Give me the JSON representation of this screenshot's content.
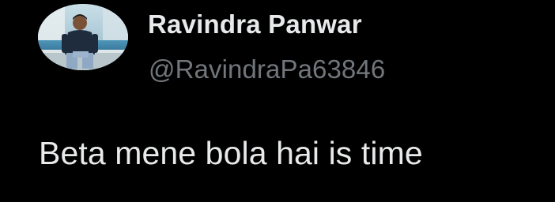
{
  "user": {
    "display_name": "Ravindra Panwar",
    "handle": "@RavindraPa63846",
    "avatar_icon": "profile-photo"
  },
  "tweet": {
    "text": "Beta mene bola hai is time"
  },
  "colors": {
    "background": "#000000",
    "primary_text": "#e7e9ea",
    "secondary_text": "#71767b"
  }
}
